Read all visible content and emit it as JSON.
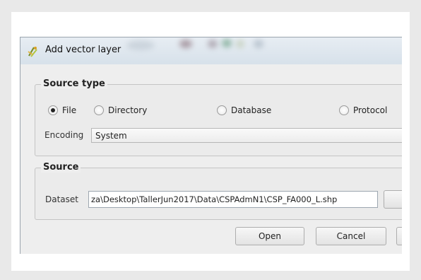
{
  "window": {
    "title": "Add vector layer",
    "icon": "qgis-add-vector-icon"
  },
  "source_type": {
    "legend": "Source type",
    "options": [
      {
        "label": "File",
        "checked": true
      },
      {
        "label": "Directory",
        "checked": false
      },
      {
        "label": "Database",
        "checked": false
      },
      {
        "label": "Protocol",
        "checked": false
      }
    ],
    "encoding_label": "Encoding",
    "encoding_value": "System"
  },
  "source": {
    "legend": "Source",
    "dataset_label": "Dataset",
    "dataset_value": "za\\Desktop\\TallerJun2017\\Data\\CSPAdmN1\\CSP_FA000_L.shp"
  },
  "buttons": {
    "open": "Open",
    "cancel": "Cancel"
  }
}
